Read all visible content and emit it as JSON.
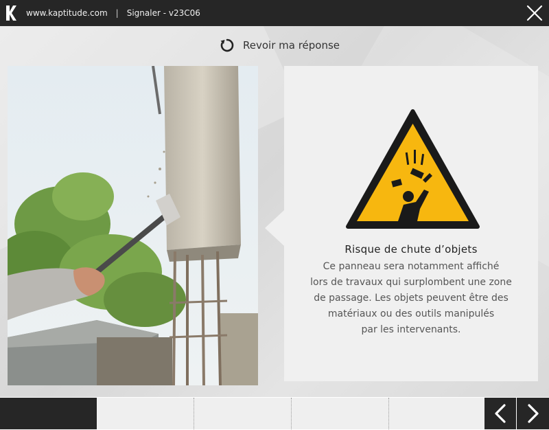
{
  "header": {
    "site": "www.kaptitude.com",
    "separator": "|",
    "module": "Signaler - v23C06"
  },
  "review": {
    "label": "Revoir ma réponse",
    "icon": "refresh-icon"
  },
  "info": {
    "title": "Risque de chute d’objets",
    "lines": [
      "Ce panneau sera notamment affiché",
      "lors de travaux qui surplombent une zone",
      "de passage. Les objets peuvent être des",
      "matériaux ou des outils manipulés",
      "par les intervenants."
    ]
  },
  "colors": {
    "bar": "#262626",
    "sign_yellow": "#f7b70f",
    "panel": "#f0f0f0"
  },
  "progress": {
    "steps": 5,
    "current": 1
  },
  "icons": {
    "logo": "kaptitude-logo",
    "close": "close-icon",
    "prev": "chevron-left-icon",
    "next": "chevron-right-icon",
    "sign": "falling-objects-warning-sign"
  }
}
